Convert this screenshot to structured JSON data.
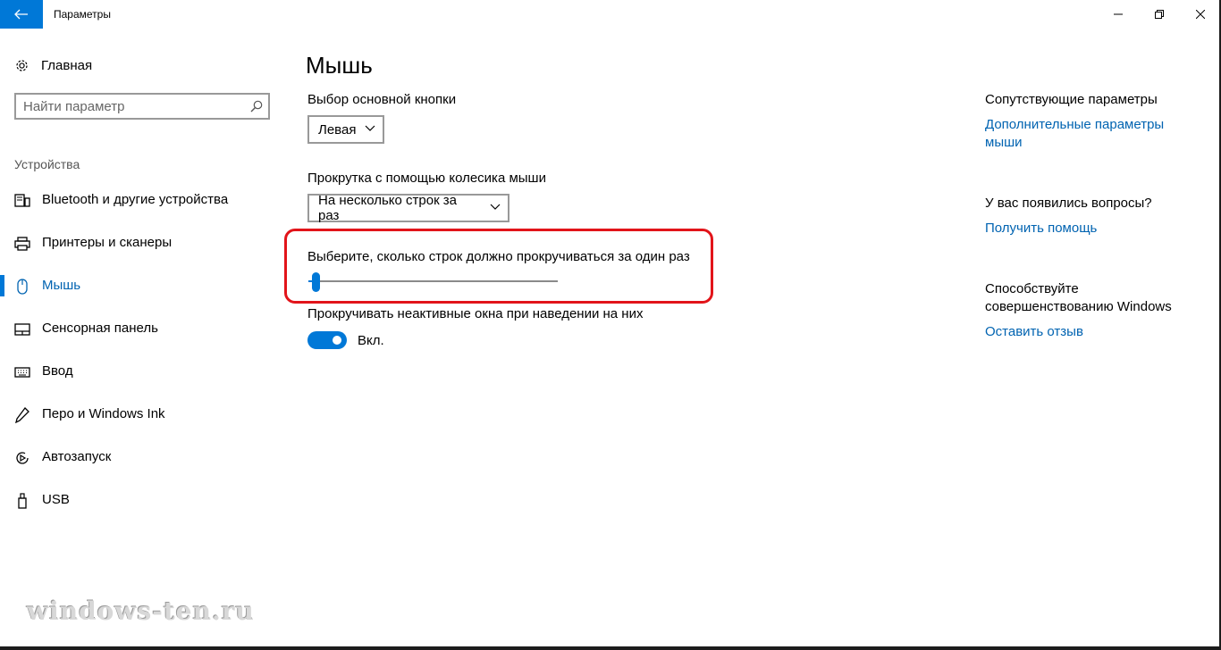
{
  "window": {
    "title": "Параметры"
  },
  "sidebar": {
    "home_label": "Главная",
    "search_placeholder": "Найти параметр",
    "section_title": "Устройства",
    "items": [
      {
        "label": "Bluetooth и другие устройства",
        "icon": "bluetooth-devices-icon"
      },
      {
        "label": "Принтеры и сканеры",
        "icon": "printer-icon"
      },
      {
        "label": "Мышь",
        "icon": "mouse-icon",
        "active": true
      },
      {
        "label": "Сенсорная панель",
        "icon": "touchpad-icon"
      },
      {
        "label": "Ввод",
        "icon": "keyboard-icon"
      },
      {
        "label": "Перо и Windows Ink",
        "icon": "pen-icon"
      },
      {
        "label": "Автозапуск",
        "icon": "autoplay-icon"
      },
      {
        "label": "USB",
        "icon": "usb-icon"
      }
    ]
  },
  "main": {
    "title": "Мышь",
    "primary_button_label": "Выбор основной кнопки",
    "primary_button_value": "Левая",
    "scroll_label": "Прокрутка с помощью колесика мыши",
    "scroll_value": "На несколько строк за раз",
    "lines_label": "Выберите, сколько строк должно прокручиваться за один раз",
    "lines_slider_fraction": 0.03,
    "inactive_label": "Прокручивать неактивные окна при наведении на них",
    "inactive_toggle_state": "Вкл."
  },
  "related": {
    "heading": "Сопутствующие параметры",
    "link": "Дополнительные параметры мыши",
    "questions_heading": "У вас появились вопросы?",
    "help_link": "Получить помощь",
    "improve_heading": "Способствуйте совершенствованию Windows",
    "feedback_link": "Оставить отзыв"
  },
  "watermark": "windows-ten.ru",
  "colors": {
    "accent": "#0078d7",
    "link": "#0063b1",
    "highlight": "#e2141a"
  }
}
